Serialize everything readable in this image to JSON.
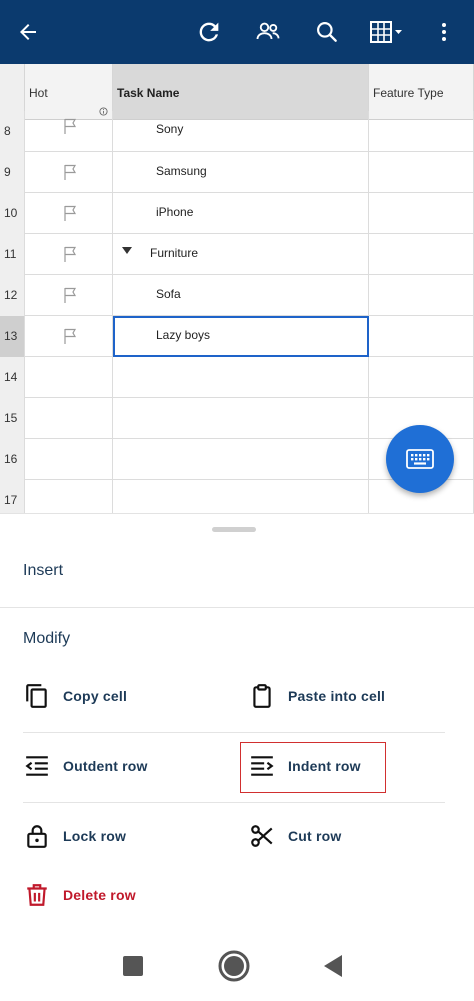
{
  "appbar": {
    "bg_color": "#0b3a6e",
    "icons": [
      "back-arrow-icon",
      "refresh-icon",
      "people-icon",
      "search-icon",
      "grid-view-icon",
      "more-vert-icon"
    ]
  },
  "grid": {
    "columns": {
      "hot": "Hot",
      "task": "Task Name",
      "feature": "Feature Type"
    },
    "rows": [
      {
        "num": "8",
        "task": "Sony"
      },
      {
        "num": "9",
        "task": "Samsung"
      },
      {
        "num": "10",
        "task": "iPhone"
      },
      {
        "num": "11",
        "task": "Furniture"
      },
      {
        "num": "12",
        "task": "Sofa"
      },
      {
        "num": "13",
        "task": "Lazy boys"
      },
      {
        "num": "14",
        "task": ""
      },
      {
        "num": "15",
        "task": ""
      },
      {
        "num": "16",
        "task": ""
      },
      {
        "num": "17",
        "task": ""
      }
    ],
    "selection_color": "#1e63c9"
  },
  "sheet": {
    "insert_title": "Insert",
    "modify_title": "Modify",
    "actions": {
      "copy_cell": "Copy cell",
      "paste_into_cell": "Paste into cell",
      "outdent_row": "Outdent row",
      "indent_row": "Indent row",
      "lock_row": "Lock row",
      "cut_row": "Cut row",
      "delete_row": "Delete row"
    },
    "danger_color": "#c0192b"
  },
  "accent_color": "#1f6fd6"
}
